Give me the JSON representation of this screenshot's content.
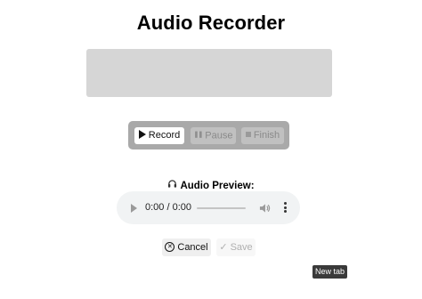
{
  "page": {
    "title": "Audio Recorder"
  },
  "controls": {
    "record_label": "Record",
    "pause_label": "Pause",
    "finish_label": "Finish"
  },
  "preview": {
    "label": "Audio Preview:",
    "time": "0:00 / 0:00",
    "progress": 0
  },
  "actions": {
    "cancel_label": "Cancel",
    "save_label": "Save"
  },
  "tooltip": {
    "text": "New tab"
  },
  "icons": {
    "record": "play-icon",
    "pause": "pause-icon",
    "finish": "stop-icon",
    "preview": "headphones-icon",
    "cancel": "close-circle-icon",
    "save": "checkmark-icon"
  },
  "colors": {
    "visualizer": "#d6d6d6",
    "controls_bar": "#a9a9a9",
    "player_bg": "#f1f3f4"
  }
}
